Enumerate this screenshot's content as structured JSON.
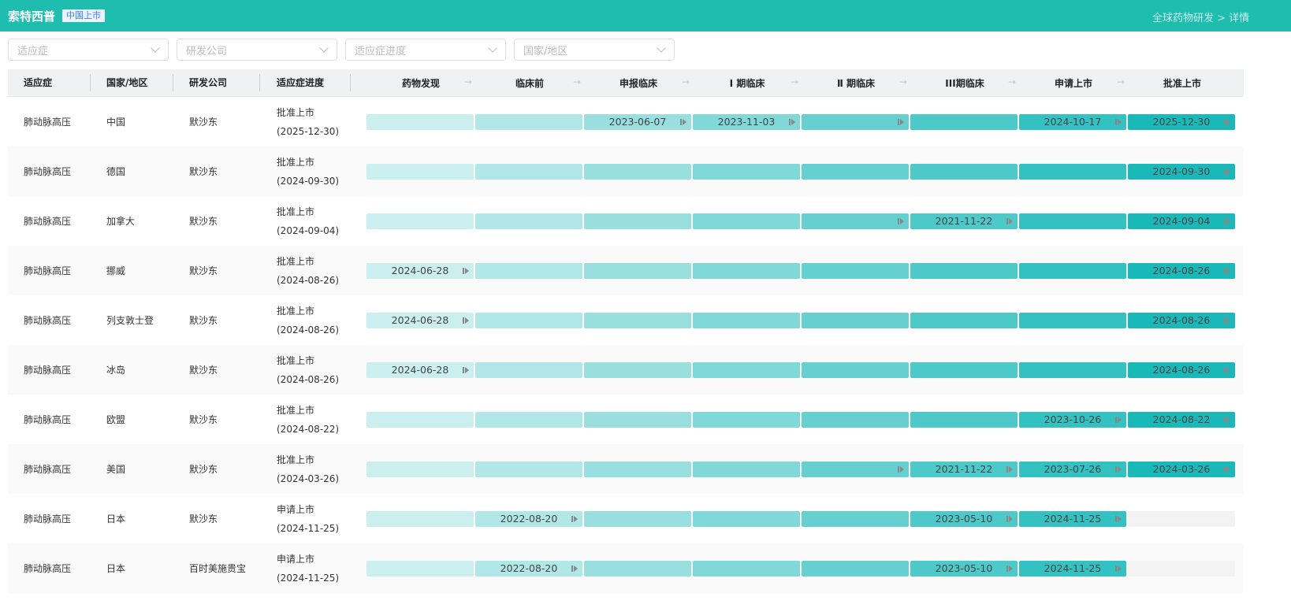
{
  "header": {
    "title": "索特西普",
    "badge": "中国上市",
    "breadcrumb": "全球药物研发 > 详情"
  },
  "filters": [
    {
      "placeholder": "适应症"
    },
    {
      "placeholder": "研发公司"
    },
    {
      "placeholder": "适应症进度"
    },
    {
      "placeholder": "国家/地区"
    }
  ],
  "columns": {
    "indication": "适应症",
    "country": "国家/地区",
    "company": "研发公司",
    "progress": "适应症进度"
  },
  "stages": [
    "药物发现",
    "临床前",
    "申报临床",
    "Ⅰ 期临床",
    "Ⅱ 期临床",
    "III期临床",
    "申请上市",
    "批准上市"
  ],
  "stage_colors": [
    "#cbeeee",
    "#b2e7e7",
    "#99dfdf",
    "#80d8d8",
    "#66d0d0",
    "#4dc9c9",
    "#33c1c1",
    "#1ab9b9"
  ],
  "rows": [
    {
      "indication": "肺动脉高压",
      "country": "中国",
      "company": "默沙东",
      "status": "批准上市",
      "date": "(2025-12-30)",
      "cells": [
        null,
        null,
        "2023-06-07",
        "2023-11-03",
        "",
        "",
        "2024-10-17",
        "2025-12-30"
      ],
      "markers": [
        0,
        0,
        1,
        1,
        1,
        0,
        1,
        1
      ]
    },
    {
      "indication": "肺动脉高压",
      "country": "德国",
      "company": "默沙东",
      "status": "批准上市",
      "date": "(2024-09-30)",
      "cells": [
        null,
        null,
        null,
        null,
        null,
        null,
        null,
        "2024-09-30"
      ],
      "markers": [
        0,
        0,
        0,
        0,
        0,
        0,
        0,
        1
      ]
    },
    {
      "indication": "肺动脉高压",
      "country": "加拿大",
      "company": "默沙东",
      "status": "批准上市",
      "date": "(2024-09-04)",
      "cells": [
        null,
        null,
        null,
        null,
        "",
        "2021-11-22",
        null,
        "2024-09-04"
      ],
      "markers": [
        0,
        0,
        0,
        0,
        1,
        1,
        0,
        1
      ]
    },
    {
      "indication": "肺动脉高压",
      "country": "挪威",
      "company": "默沙东",
      "status": "批准上市",
      "date": "(2024-08-26)",
      "cells": [
        "2024-06-28",
        null,
        null,
        null,
        null,
        null,
        null,
        "2024-08-26"
      ],
      "markers": [
        1,
        0,
        0,
        0,
        0,
        0,
        0,
        1
      ]
    },
    {
      "indication": "肺动脉高压",
      "country": "列支敦士登",
      "company": "默沙东",
      "status": "批准上市",
      "date": "(2024-08-26)",
      "cells": [
        "2024-06-28",
        null,
        null,
        null,
        null,
        null,
        null,
        "2024-08-26"
      ],
      "markers": [
        1,
        0,
        0,
        0,
        0,
        0,
        0,
        1
      ]
    },
    {
      "indication": "肺动脉高压",
      "country": "冰岛",
      "company": "默沙东",
      "status": "批准上市",
      "date": "(2024-08-26)",
      "cells": [
        "2024-06-28",
        null,
        null,
        null,
        null,
        null,
        null,
        "2024-08-26"
      ],
      "markers": [
        1,
        0,
        0,
        0,
        0,
        0,
        0,
        1
      ]
    },
    {
      "indication": "肺动脉高压",
      "country": "欧盟",
      "company": "默沙东",
      "status": "批准上市",
      "date": "(2024-08-22)",
      "cells": [
        null,
        null,
        null,
        null,
        null,
        null,
        "2023-10-26",
        "2024-08-22"
      ],
      "markers": [
        0,
        0,
        0,
        0,
        0,
        0,
        1,
        1
      ]
    },
    {
      "indication": "肺动脉高压",
      "country": "美国",
      "company": "默沙东",
      "status": "批准上市",
      "date": "(2024-03-26)",
      "cells": [
        null,
        null,
        null,
        null,
        "",
        "2021-11-22",
        "2023-07-26",
        "2024-03-26"
      ],
      "markers": [
        0,
        0,
        0,
        0,
        1,
        1,
        1,
        1
      ]
    },
    {
      "indication": "肺动脉高压",
      "country": "日本",
      "company": "默沙东",
      "status": "申请上市",
      "date": "(2024-11-25)",
      "cells": [
        null,
        "2022-08-20",
        null,
        null,
        null,
        "2023-05-10",
        "2024-11-25",
        null
      ],
      "markers": [
        0,
        1,
        0,
        0,
        0,
        1,
        1,
        0
      ],
      "reached": 7
    },
    {
      "indication": "肺动脉高压",
      "country": "日本",
      "company": "百时美施贵宝",
      "status": "申请上市",
      "date": "(2024-11-25)",
      "cells": [
        null,
        "2022-08-20",
        null,
        null,
        null,
        "2023-05-10",
        "2024-11-25",
        null
      ],
      "markers": [
        0,
        1,
        0,
        0,
        0,
        1,
        1,
        0
      ],
      "reached": 7
    }
  ]
}
